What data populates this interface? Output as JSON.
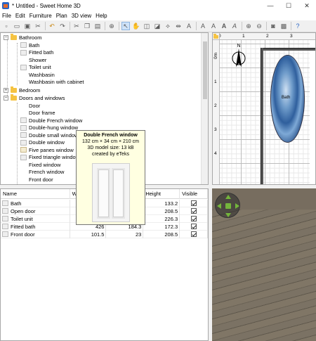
{
  "window": {
    "title": "* Untitled - Sweet Home 3D",
    "controls": {
      "minimize": "—",
      "maximize": "☐",
      "close": "✕"
    }
  },
  "menu": [
    "File",
    "Edit",
    "Furniture",
    "Plan",
    "3D view",
    "Help"
  ],
  "toolbar": {
    "icons": [
      "new-icon",
      "open-icon",
      "save-icon",
      "cut-preferences-icon",
      "undo-icon",
      "redo-icon",
      "cut-icon",
      "copy-icon",
      "paste-icon",
      "add-furniture-icon",
      "select-icon",
      "pan-icon",
      "create-walls-icon",
      "create-rooms-icon",
      "create-dimensions-icon",
      "create-labels-icon",
      "increase-text-icon",
      "decrease-text-icon",
      "bold-icon",
      "italic-icon",
      "zoom-in-icon",
      "zoom-out-icon",
      "photo-icon",
      "video-icon",
      "help-icon"
    ],
    "selected": "select-icon"
  },
  "catalog": {
    "rows": [
      {
        "kind": "category",
        "label": "Bathroom",
        "expanded": true
      },
      {
        "kind": "item",
        "label": "Bath"
      },
      {
        "kind": "item",
        "label": "Fitted bath"
      },
      {
        "kind": "item",
        "label": "Shower"
      },
      {
        "kind": "item",
        "label": "Toilet unit"
      },
      {
        "kind": "item",
        "label": "Washbasin"
      },
      {
        "kind": "item",
        "label": "Washbasin with cabinet"
      },
      {
        "kind": "category",
        "label": "Bedroom",
        "expanded": false
      },
      {
        "kind": "category",
        "label": "Doors and windows",
        "expanded": true
      },
      {
        "kind": "item",
        "label": "Door"
      },
      {
        "kind": "item",
        "label": "Door frame"
      },
      {
        "kind": "item",
        "label": "Double French window"
      },
      {
        "kind": "item",
        "label": "Double-hung window"
      },
      {
        "kind": "item",
        "label": "Double small window"
      },
      {
        "kind": "item",
        "label": "Double window"
      },
      {
        "kind": "item",
        "label": "Five panes window"
      },
      {
        "kind": "item",
        "label": "Fixed triangle window"
      },
      {
        "kind": "item",
        "label": "Fixed window"
      },
      {
        "kind": "item",
        "label": "French window"
      },
      {
        "kind": "item",
        "label": "Front door"
      }
    ]
  },
  "tooltip": {
    "title": "Double French window",
    "size": "132 cm × 34 cm × 210 cm",
    "model_size": "3D model size: 13 kB",
    "creator": "created by eTeks"
  },
  "furniture_table": {
    "columns": [
      "Name",
      "W",
      "",
      "Height",
      "Visible"
    ],
    "rows": [
      {
        "name": "Bath",
        "width": "",
        "depth": "",
        "height": "133.2",
        "visible": true
      },
      {
        "name": "Open door",
        "width": "",
        "depth": "",
        "height": "208.5",
        "visible": true
      },
      {
        "name": "Toilet unit",
        "width": "",
        "depth": "",
        "height": "226.3",
        "visible": true
      },
      {
        "name": "Fitted bath",
        "width": "426",
        "depth": "184.3",
        "height": "172.3",
        "visible": true
      },
      {
        "name": "Front door",
        "width": "101.5",
        "depth": "23",
        "height": "208.5",
        "visible": true
      }
    ]
  },
  "plan": {
    "ruler_top": [
      "0",
      "1",
      "2",
      "3"
    ],
    "ruler_left": [
      "0m",
      "1",
      "2",
      "3",
      "4"
    ],
    "compass_label": "N",
    "bath_label": "Bath"
  }
}
